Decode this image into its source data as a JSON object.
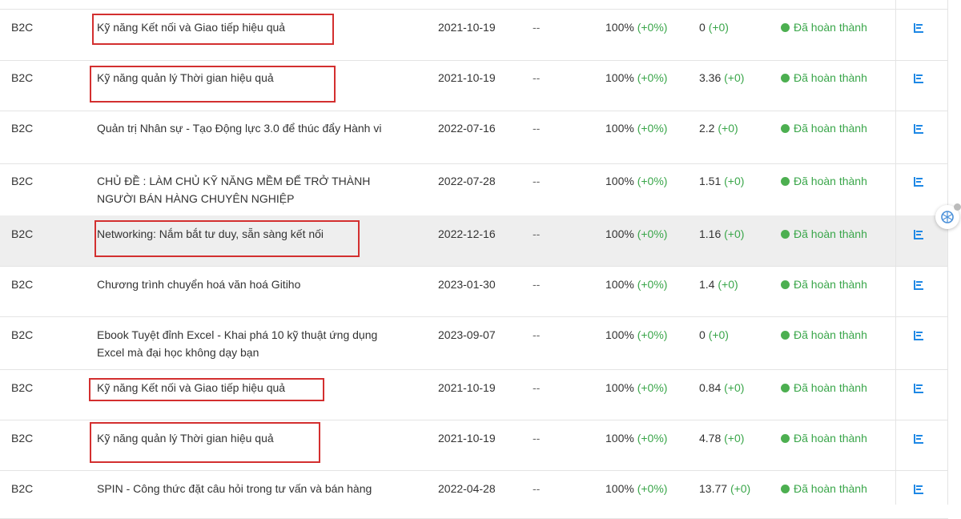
{
  "table": {
    "rows": [
      {
        "type": "B2C",
        "name": "Kỹ năng Kết nối và Giao tiếp hiệu quả",
        "date": "2021-10-19",
        "end": "--",
        "progress": "100%",
        "progress_delta": "(+0%)",
        "score": "0",
        "score_delta": "(+0)",
        "status": "Đã hoàn thành"
      },
      {
        "type": "B2C",
        "name": "Kỹ năng quản lý Thời gian hiệu quả",
        "date": "2021-10-19",
        "end": "--",
        "progress": "100%",
        "progress_delta": "(+0%)",
        "score": "3.36",
        "score_delta": "(+0)",
        "status": "Đã hoàn thành"
      },
      {
        "type": "B2C",
        "name": "Quản trị Nhân sự - Tạo Động lực 3.0 để thúc đẩy Hành vi",
        "date": "2022-07-16",
        "end": "--",
        "progress": "100%",
        "progress_delta": "(+0%)",
        "score": "2.2",
        "score_delta": "(+0)",
        "status": "Đã hoàn thành"
      },
      {
        "type": "B2C",
        "name": "CHỦ ĐỀ : LÀM CHỦ KỸ NĂNG MỀM ĐỂ TRỞ THÀNH NGƯỜI BÁN HÀNG CHUYÊN NGHIỆP",
        "date": "2022-07-28",
        "end": "--",
        "progress": "100%",
        "progress_delta": "(+0%)",
        "score": "1.51",
        "score_delta": "(+0)",
        "status": "Đã hoàn thành"
      },
      {
        "type": "B2C",
        "name": "Networking: Nắm bắt tư duy, sẵn sàng kết nối",
        "date": "2022-12-16",
        "end": "--",
        "progress": "100%",
        "progress_delta": "(+0%)",
        "score": "1.16",
        "score_delta": "(+0)",
        "status": "Đã hoàn thành"
      },
      {
        "type": "B2C",
        "name": "Chương trình chuyển hoá văn hoá Gitiho",
        "date": "2023-01-30",
        "end": "--",
        "progress": "100%",
        "progress_delta": "(+0%)",
        "score": "1.4",
        "score_delta": "(+0)",
        "status": "Đã hoàn thành"
      },
      {
        "type": "B2C",
        "name": "Ebook Tuyệt đỉnh Excel - Khai phá 10 kỹ thuật ứng dụng Excel mà đại học không dạy bạn",
        "date": "2023-09-07",
        "end": "--",
        "progress": "100%",
        "progress_delta": "(+0%)",
        "score": "0",
        "score_delta": "(+0)",
        "status": "Đã hoàn thành"
      },
      {
        "type": "B2C",
        "name": "Kỹ năng Kết nối và Giao tiếp hiệu quả",
        "date": "2021-10-19",
        "end": "--",
        "progress": "100%",
        "progress_delta": "(+0%)",
        "score": "0.84",
        "score_delta": "(+0)",
        "status": "Đã hoàn thành"
      },
      {
        "type": "B2C",
        "name": "Kỹ năng quản lý Thời gian hiệu quả",
        "date": "2021-10-19",
        "end": "--",
        "progress": "100%",
        "progress_delta": "(+0%)",
        "score": "4.78",
        "score_delta": "(+0)",
        "status": "Đã hoàn thành"
      },
      {
        "type": "B2C",
        "name": "SPIN - Công thức đặt câu hỏi trong tư vấn và bán hàng",
        "date": "2022-04-28",
        "end": "--",
        "progress": "100%",
        "progress_delta": "(+0%)",
        "score": "13.77",
        "score_delta": "(+0)",
        "status": "Đã hoàn thành"
      }
    ]
  },
  "colors": {
    "status_green": "#3aa64a",
    "annotation_red": "#d32f2f",
    "action_blue": "#1e88e5"
  },
  "icons": {
    "row_action": "report-chart-icon",
    "floating": "chatgpt-icon"
  }
}
